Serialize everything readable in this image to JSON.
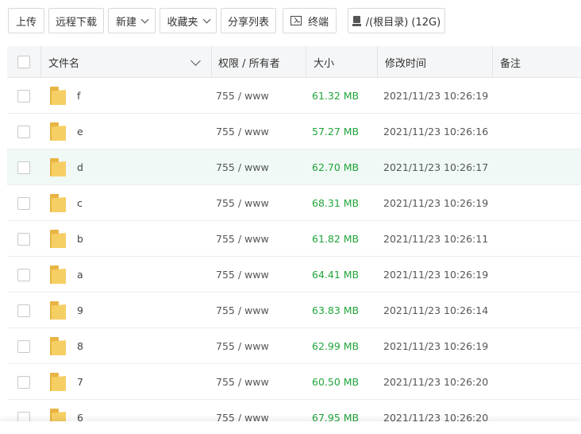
{
  "toolbar": {
    "upload": "上传",
    "remote_download": "远程下载",
    "new": "新建",
    "favorites": "收藏夹",
    "share_list": "分享列表",
    "terminal": "终端",
    "disk": "/(根目录) (12G)"
  },
  "table": {
    "columns": {
      "name": "文件名",
      "perm_owner": "权限 / 所有者",
      "size": "大小",
      "modified": "修改时间",
      "note": "备注"
    },
    "rows": [
      {
        "name": "f",
        "perm": "755 / www",
        "size": "61.32 MB",
        "mtime": "2021/11/23 10:26:19"
      },
      {
        "name": "e",
        "perm": "755 / www",
        "size": "57.27 MB",
        "mtime": "2021/11/23 10:26:16"
      },
      {
        "name": "d",
        "perm": "755 / www",
        "size": "62.70 MB",
        "mtime": "2021/11/23 10:26:17"
      },
      {
        "name": "c",
        "perm": "755 / www",
        "size": "68.31 MB",
        "mtime": "2021/11/23 10:26:19"
      },
      {
        "name": "b",
        "perm": "755 / www",
        "size": "61.82 MB",
        "mtime": "2021/11/23 10:26:11"
      },
      {
        "name": "a",
        "perm": "755 / www",
        "size": "64.41 MB",
        "mtime": "2021/11/23 10:26:19"
      },
      {
        "name": "9",
        "perm": "755 / www",
        "size": "63.83 MB",
        "mtime": "2021/11/23 10:26:14"
      },
      {
        "name": "8",
        "perm": "755 / www",
        "size": "62.99 MB",
        "mtime": "2021/11/23 10:26:19"
      },
      {
        "name": "7",
        "perm": "755 / www",
        "size": "60.50 MB",
        "mtime": "2021/11/23 10:26:20"
      },
      {
        "name": "6",
        "perm": "755 / www",
        "size": "67.95 MB",
        "mtime": "2021/11/23 10:26:20"
      }
    ]
  },
  "icons": {
    "folder": "folder-icon",
    "terminal": "terminal-icon",
    "disk": "disk-icon",
    "dropdown": "chevron-down-icon"
  },
  "colors": {
    "size_text": "#20a53a",
    "highlight_row": "#f0f9f5",
    "folder": "#f6cf64"
  }
}
